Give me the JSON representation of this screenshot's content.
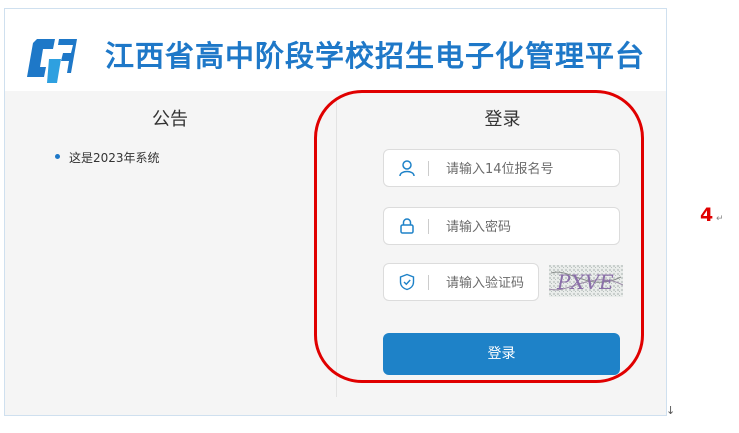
{
  "header": {
    "title": "江西省高中阶段学校招生电子化管理平台",
    "logo_icon": "jx-platform-logo-icon",
    "brand_color": "#1e78c8"
  },
  "notice": {
    "title": "公告",
    "items": [
      "这是2023年系统"
    ]
  },
  "login": {
    "title": "登录",
    "username": {
      "placeholder": "请输入14位报名号",
      "value": "",
      "icon": "user-icon"
    },
    "password": {
      "placeholder": "请输入密码",
      "value": "",
      "icon": "lock-icon"
    },
    "captcha": {
      "placeholder": "请输入验证码",
      "value": "",
      "icon": "shield-check-icon",
      "image_text": "PXVE"
    },
    "submit_label": "登录",
    "button_color": "#1e82c8"
  },
  "annotation": {
    "label": "4",
    "return_mark": "↵",
    "end_mark": "↓",
    "color": "#e00000"
  }
}
